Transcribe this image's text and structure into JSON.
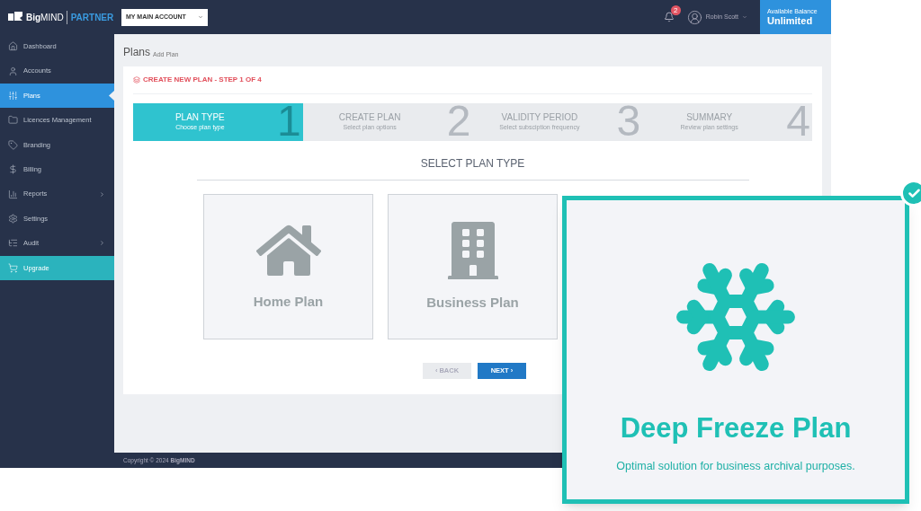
{
  "brand": {
    "logo": "**Big**MIND",
    "product": "PARTNER"
  },
  "account_select": {
    "value": "MY MAIN ACCOUNT"
  },
  "topbar": {
    "notifications": "2",
    "user": "Robin Scott",
    "balance_label": "Available Balance",
    "balance_value": "Unlimited"
  },
  "sidebar": {
    "items": [
      {
        "label": "Dashboard",
        "selected": false,
        "kind": "nav",
        "submenu": false
      },
      {
        "label": "Accounts",
        "selected": false,
        "kind": "nav",
        "submenu": false
      },
      {
        "label": "Plans",
        "selected": true,
        "kind": "nav",
        "submenu": false
      },
      {
        "label": "Licences Management",
        "selected": false,
        "kind": "nav",
        "submenu": false
      },
      {
        "label": "Branding",
        "selected": false,
        "kind": "nav",
        "submenu": false
      },
      {
        "label": "Billing",
        "selected": false,
        "kind": "nav",
        "submenu": false
      },
      {
        "label": "Reports",
        "selected": false,
        "kind": "nav",
        "submenu": true
      },
      {
        "label": "Settings",
        "selected": false,
        "kind": "nav",
        "submenu": false
      },
      {
        "label": "Audit",
        "selected": false,
        "kind": "nav",
        "submenu": true
      },
      {
        "label": "Upgrade",
        "selected": false,
        "kind": "promo",
        "submenu": false
      }
    ]
  },
  "page": {
    "title": "Plans",
    "subtitle": "Add Plan"
  },
  "wizard": {
    "heading": "CREATE NEW PLAN - STEP 1 OF 4",
    "steps": [
      {
        "number": "1",
        "title": "PLAN TYPE",
        "subtitle": "Choose plan type",
        "selected": true
      },
      {
        "number": "2",
        "title": "CREATE PLAN",
        "subtitle": "Select plan options",
        "selected": false
      },
      {
        "number": "3",
        "title": "VALIDITY PERIOD",
        "subtitle": "Select subsciption frequency",
        "selected": false
      },
      {
        "number": "4",
        "title": "SUMMARY",
        "subtitle": "Review plan settings",
        "selected": false
      }
    ],
    "section_title": "SELECT PLAN TYPE",
    "plans": [
      {
        "name": "Home Plan",
        "selected": false
      },
      {
        "name": "Business Plan",
        "selected": false
      },
      {
        "name": "Deep Freeze Plan",
        "selected": true,
        "description": "Optimal solution for business archival purposes."
      }
    ],
    "buttons": [
      {
        "label": "‹ BACK",
        "kind": "back",
        "disabled": true
      },
      {
        "label": "NEXT ›",
        "kind": "next",
        "disabled": false
      }
    ]
  },
  "footer": {
    "text": "Copyright © 2024 **BigMIND**"
  }
}
